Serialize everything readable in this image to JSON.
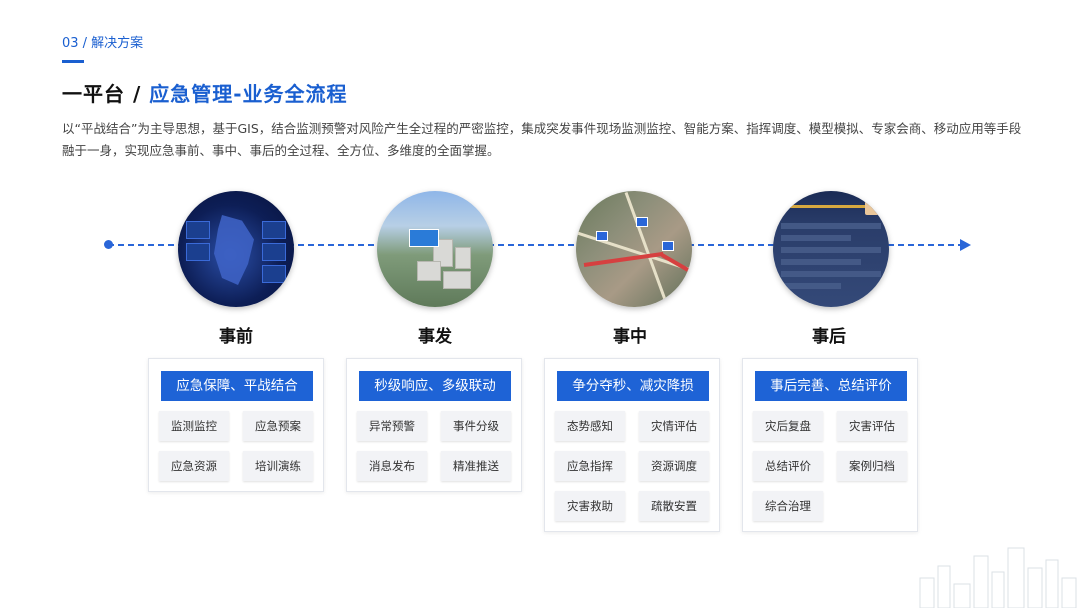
{
  "header": {
    "section_tag": "03 / 解决方案",
    "title_main": "一平台 / ",
    "title_highlight": "应急管理-业务全流程",
    "description": "以“平战结合”为主导思想，基于GIS，结合监测预警对风险产生全过程的严密监控，集成突发事件现场监测监控、智能方案、指挥调度、模型模拟、专家会商、移动应用等手段融于一身，实现应急事前、事中、事后的全过程、全方位、多维度的全面掌握。"
  },
  "colors": {
    "accent": "#1e63d6",
    "timeline": "#2a66d8"
  },
  "stages": [
    {
      "label": "事前",
      "head": "应急保障、平战结合",
      "items": [
        "监测监控",
        "应急预案",
        "应急资源",
        "培训演练"
      ]
    },
    {
      "label": "事发",
      "head": "秒级响应、多级联动",
      "items": [
        "异常预警",
        "事件分级",
        "消息发布",
        "精准推送"
      ]
    },
    {
      "label": "事中",
      "head": "争分夺秒、减灾降损",
      "items": [
        "态势感知",
        "灾情评估",
        "应急指挥",
        "资源调度",
        "灾害救助",
        "疏散安置"
      ]
    },
    {
      "label": "事后",
      "head": "事后完善、总结评价",
      "items": [
        "灾后复盘",
        "灾害评估",
        "总结评价",
        "案例归档",
        "综合治理"
      ]
    }
  ]
}
